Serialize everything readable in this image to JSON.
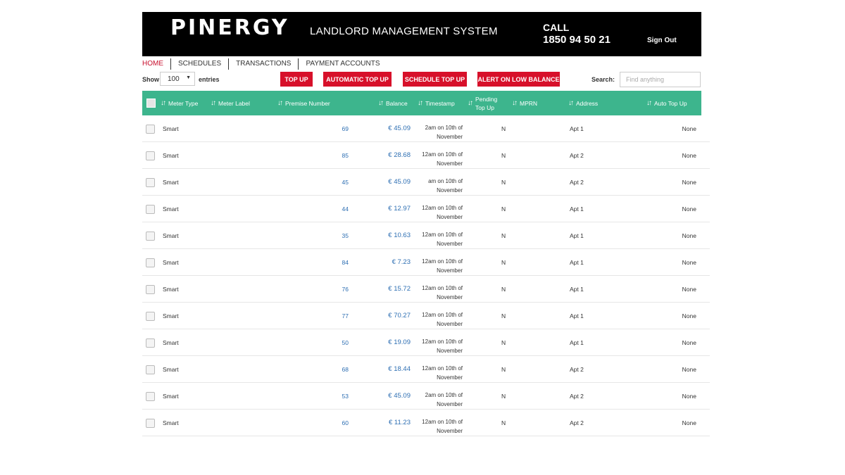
{
  "header": {
    "logo": "PINERGY",
    "title": "LANDLORD MANAGEMENT SYSTEM",
    "call_label": "CALL",
    "call_number": "1850 94 50 21",
    "sign_out": "Sign Out"
  },
  "nav": [
    "HOME",
    "SCHEDULES",
    "TRANSACTIONS",
    "PAYMENT ACCOUNTS"
  ],
  "controls": {
    "show": "Show",
    "entries_value": "100",
    "entries": "entries",
    "buttons": [
      "TOP UP",
      "AUTOMATIC TOP UP",
      "SCHEDULE TOP UP",
      "ALERT ON LOW BALANCE"
    ],
    "search_label": "Search:",
    "search_placeholder": "Find anything"
  },
  "columns": [
    "Meter Type",
    "Meter Label",
    "Premise Number",
    "Balance",
    "Timestamp",
    "Pending Top Up",
    "MPRN",
    "Address",
    "Auto Top Up"
  ],
  "colors": {
    "header_bg": "#000000",
    "accent": "#d7102a",
    "table_header": "#3db58d",
    "link": "#2e6fb3"
  },
  "rows": [
    {
      "type": "Smart",
      "premise": "69",
      "balance": "€ 45.09",
      "ts1": "2am on 10th of",
      "ts2": "November",
      "pending": "N",
      "address": "Apt 1",
      "auto": "None"
    },
    {
      "type": "Smart",
      "premise": "85",
      "balance": "€ 28.68",
      "ts1": "12am on 10th of",
      "ts2": "November",
      "pending": "N",
      "address": "Apt 2",
      "auto": "None"
    },
    {
      "type": "Smart",
      "premise": "45",
      "balance": "€ 45.09",
      "ts1": "am on 10th of",
      "ts2": "November",
      "pending": "N",
      "address": "Apt 2",
      "auto": "None"
    },
    {
      "type": "Smart",
      "premise": "44",
      "balance": "€ 12.97",
      "ts1": "12am on 10th of",
      "ts2": "November",
      "pending": "N",
      "address": "Apt 1",
      "auto": "None"
    },
    {
      "type": "Smart",
      "premise": "35",
      "balance": "€ 10.63",
      "ts1": "12am on 10th of",
      "ts2": "November",
      "pending": "N",
      "address": "Apt 1",
      "auto": "None"
    },
    {
      "type": "Smart",
      "premise": "84",
      "balance": "€ 7.23",
      "ts1": "12am on 10th of",
      "ts2": "November",
      "pending": "N",
      "address": "Apt 1",
      "auto": "None"
    },
    {
      "type": "Smart",
      "premise": "76",
      "balance": "€ 15.72",
      "ts1": "12am on 10th of",
      "ts2": "November",
      "pending": "N",
      "address": "Apt 1",
      "auto": "None"
    },
    {
      "type": "Smart",
      "premise": "77",
      "balance": "€ 70.27",
      "ts1": "12am on 10th of",
      "ts2": "November",
      "pending": "N",
      "address": "Apt 1",
      "auto": "None"
    },
    {
      "type": "Smart",
      "premise": "50",
      "balance": "€ 19.09",
      "ts1": "12am on 10th of",
      "ts2": "November",
      "pending": "N",
      "address": "Apt 1",
      "auto": "None"
    },
    {
      "type": "Smart",
      "premise": "68",
      "balance": "€ 18.44",
      "ts1": "12am on 10th of",
      "ts2": "November",
      "pending": "N",
      "address": "Apt 2",
      "auto": "None"
    },
    {
      "type": "Smart",
      "premise": "53",
      "balance": "€ 45.09",
      "ts1": "2am on 10th of",
      "ts2": "November",
      "pending": "N",
      "address": "Apt 2",
      "auto": "None"
    },
    {
      "type": "Smart",
      "premise": "60",
      "balance": "€ 11.23",
      "ts1": "12am on 10th of",
      "ts2": "November",
      "pending": "N",
      "address": "Apt 2",
      "auto": "None"
    }
  ]
}
